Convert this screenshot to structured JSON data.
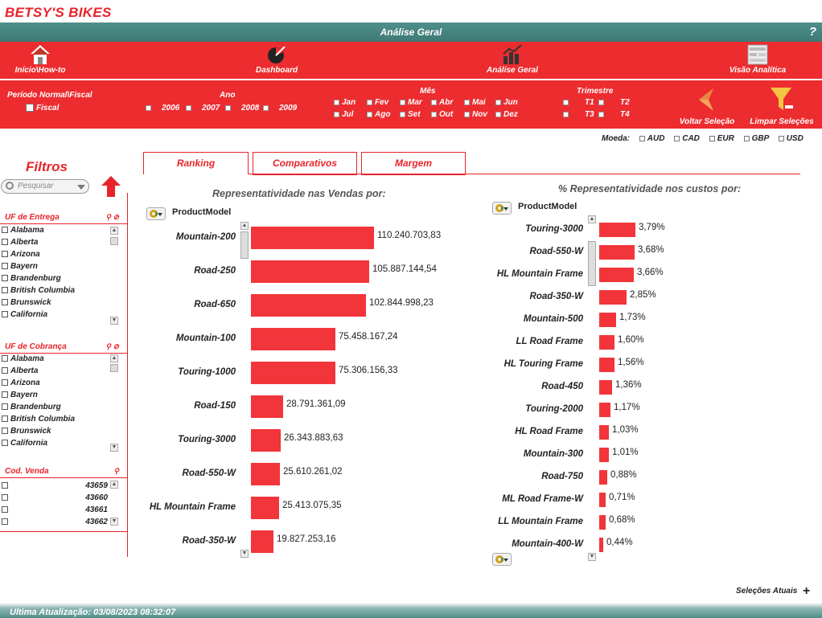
{
  "brand": "BETSY'S BIKES",
  "title": "Análise Geral",
  "help": "?",
  "nav": {
    "inicio": "Início\\How-to",
    "dashboard": "Dashboard",
    "analise": "Análise Geral",
    "visao": "Visão Analítica"
  },
  "filters": {
    "periodo_label": "Período Normal\\Fiscal",
    "fiscal": "Fiscal",
    "ano_label": "Ano",
    "anos": [
      "2006",
      "2007",
      "2008",
      "2009"
    ],
    "mes_label": "Mês",
    "meses_row1": [
      "Jan",
      "Fev",
      "Mar",
      "Abr",
      "Mai",
      "Jun"
    ],
    "meses_row2": [
      "Jul",
      "Ago",
      "Set",
      "Out",
      "Nov",
      "Dez"
    ],
    "trimestre_label": "Trimestre",
    "trimestres": [
      "T1",
      "T2",
      "T3",
      "T4"
    ],
    "voltar": "Voltar Seleção",
    "limpar": "Limpar Seleções"
  },
  "moeda": {
    "label": "Moeda:",
    "options": [
      "AUD",
      "CAD",
      "EUR",
      "GBP",
      "USD"
    ]
  },
  "sidebar": {
    "title": "Filtros",
    "search_placeholder": "Pesquisar",
    "uf_entrega": {
      "label": "UF de Entrega",
      "items": [
        "Alabama",
        "Alberta",
        "Arizona",
        "Bayern",
        "Brandenburg",
        "British Columbia",
        "Brunswick",
        "California"
      ]
    },
    "uf_cobranca": {
      "label": "UF de Cobrança",
      "items": [
        "Alabama",
        "Alberta",
        "Arizona",
        "Bayern",
        "Brandenburg",
        "British Columbia",
        "Brunswick",
        "California"
      ]
    },
    "cod_venda": {
      "label": "Cod. Venda",
      "items": [
        "43659",
        "43660",
        "43661",
        "43662"
      ]
    }
  },
  "tabs": [
    "Ranking",
    "Comparativos",
    "Margem"
  ],
  "charts": {
    "vendas_title": "Representatividade nas Vendas por:",
    "custos_title": "% Representatividade nos custos por:",
    "dimension": "ProductModel"
  },
  "chart_data": [
    {
      "type": "bar",
      "orientation": "horizontal",
      "title": "Representatividade nas Vendas por:",
      "dimension": "ProductModel",
      "categories": [
        "Mountain-200",
        "Road-250",
        "Road-650",
        "Mountain-100",
        "Touring-1000",
        "Road-150",
        "Touring-3000",
        "Road-550-W",
        "HL Mountain Frame",
        "Road-350-W"
      ],
      "values": [
        110240703.83,
        105887144.54,
        102844998.23,
        75458167.24,
        75306156.33,
        28791361.09,
        26343883.63,
        25610261.02,
        25413075.35,
        19827253.16
      ],
      "labels": [
        "110.240.703,83",
        "105.887.144,54",
        "102.844.998,23",
        "75.458.167,24",
        "75.306.156,33",
        "28.791.361,09",
        "26.343.883,63",
        "25.610.261,02",
        "25.413.075,35",
        "19.827.253,16"
      ]
    },
    {
      "type": "bar",
      "orientation": "horizontal",
      "title": "% Representatividade nos custos por:",
      "dimension": "ProductModel",
      "categories": [
        "Touring-3000",
        "Road-550-W",
        "HL Mountain Frame",
        "Road-350-W",
        "Mountain-500",
        "LL Road Frame",
        "HL Touring Frame",
        "Road-450",
        "Touring-2000",
        "HL Road Frame",
        "Mountain-300",
        "Road-750",
        "ML Road Frame-W",
        "LL Mountain Frame",
        "Mountain-400-W"
      ],
      "values": [
        3.79,
        3.68,
        3.66,
        2.85,
        1.73,
        1.6,
        1.56,
        1.36,
        1.17,
        1.03,
        1.01,
        0.88,
        0.71,
        0.68,
        0.44
      ],
      "labels": [
        "3,79%",
        "3,68%",
        "3,66%",
        "2,85%",
        "1,73%",
        "1,60%",
        "1,56%",
        "1,36%",
        "1,17%",
        "1,03%",
        "1,01%",
        "0,88%",
        "0,71%",
        "0,68%",
        "0,44%"
      ]
    }
  ],
  "selecoes_atuais": "Seleções Atuais",
  "footer": "Ultima Atualização: 03/08/2023 08:32:07",
  "colors": {
    "accent": "#e8232a",
    "bar": "#f2353a",
    "header_teal": "#4f8f8a"
  }
}
